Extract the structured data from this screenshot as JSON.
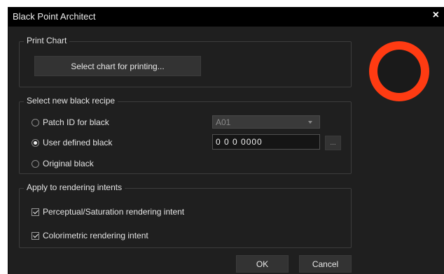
{
  "window": {
    "title": "Black Point Architect",
    "close_glyph": "×"
  },
  "print_chart": {
    "legend": "Print Chart",
    "select_button": "Select chart for printing..."
  },
  "black_recipe": {
    "legend": "Select new black recipe",
    "patch_id_label": "Patch ID for black",
    "patch_id_value": "A01",
    "user_defined_label": "User defined black",
    "user_defined_value": "0 0 0 0000",
    "browse_button": "...",
    "original_label": "Original black",
    "selected": "user_defined"
  },
  "rendering": {
    "legend": "Apply to rendering intents",
    "perceptual_label": "Perceptual/Saturation rendering intent",
    "perceptual_checked": true,
    "colorimetric_label": "Colorimetric rendering intent",
    "colorimetric_checked": true
  },
  "footer": {
    "ok": "OK",
    "cancel": "Cancel"
  },
  "colors": {
    "window_bg": "#1f1f1f",
    "titlebar_bg": "#000000",
    "ring_outer": "#ff3b12",
    "ring_inner": "#1a1a1a"
  }
}
